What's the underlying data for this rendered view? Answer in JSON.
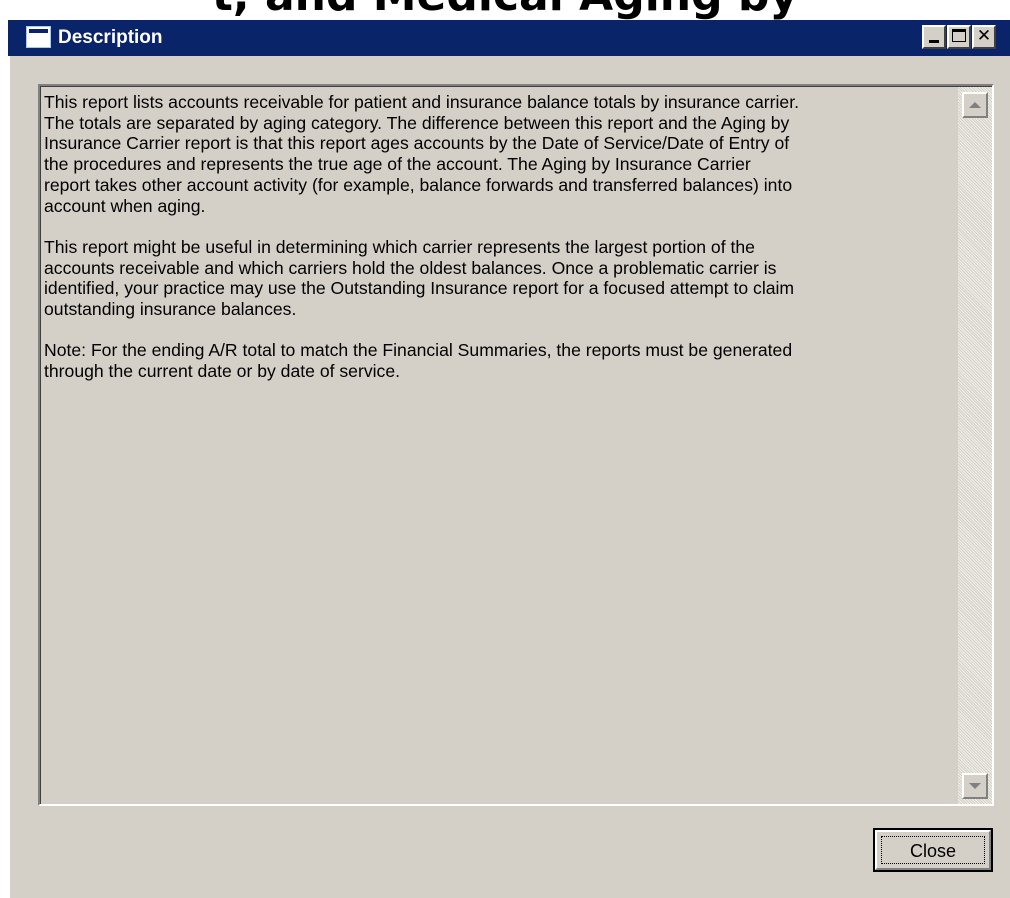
{
  "background_heading": "t, and Medical Aging by",
  "window": {
    "title": "Description",
    "buttons": {
      "minimize": "minimize",
      "maximize": "maximize",
      "close_glyph": "✕"
    }
  },
  "description": {
    "paragraphs": [
      "This report lists accounts receivable for patient and insurance balance totals by insurance carrier.\nThe totals are separated by aging category. The difference between this report and the Aging by\nInsurance Carrier report is that this report ages accounts by the Date of Service/Date of Entry of\nthe procedures and represents the true age of the account. The Aging by Insurance Carrier\nreport takes other account activity (for example, balance forwards and transferred balances) into\naccount when aging.",
      "This report might be useful in determining which carrier represents the largest portion of the\naccounts receivable and which carriers hold the oldest balances. Once a problematic carrier is\nidentified, your practice may use the Outstanding Insurance report for a focused attempt to claim\noutstanding insurance balances.",
      "Note: For the ending A/R total to match the Financial Summaries, the reports must be generated\nthrough the current date or by date of service."
    ]
  },
  "footer": {
    "close_label": "Close"
  },
  "colors": {
    "titlebar": "#0a246a",
    "window_face": "#d4d0c8"
  }
}
